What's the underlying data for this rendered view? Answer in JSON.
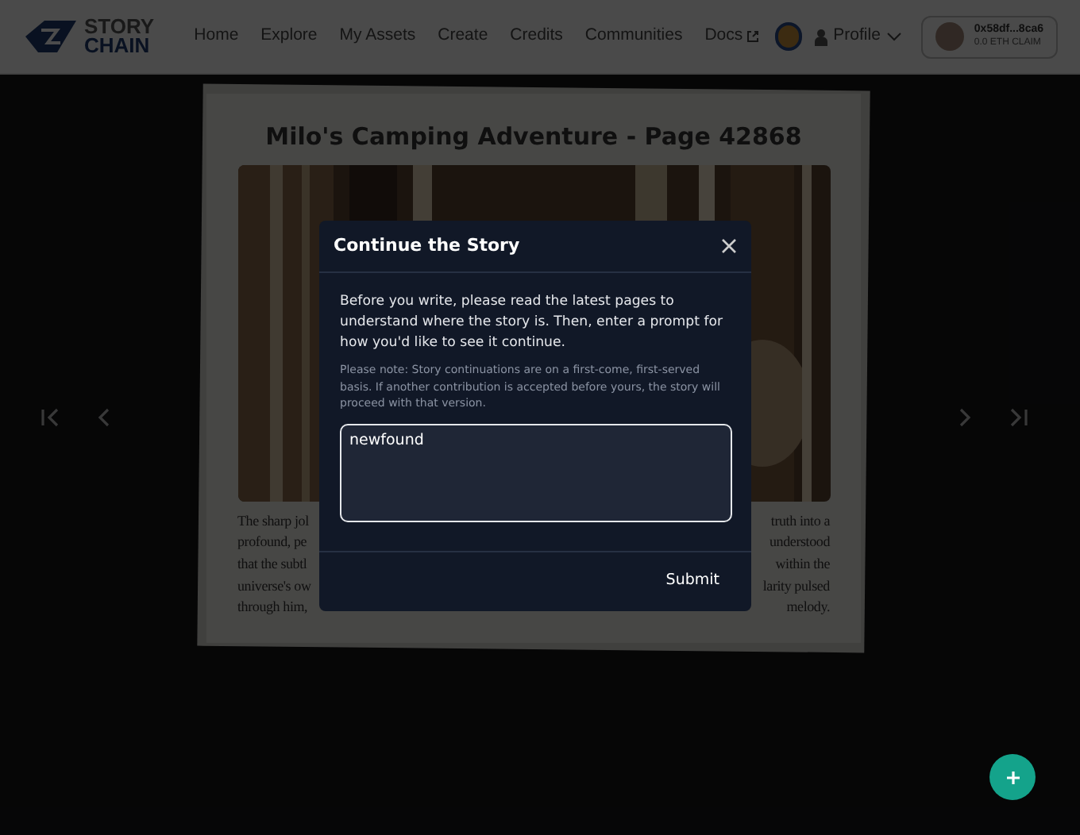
{
  "nav": {
    "logo_top": "STORY",
    "logo_bottom": "CHAIN",
    "links": [
      {
        "label": "Home"
      },
      {
        "label": "Explore"
      },
      {
        "label": "My Assets"
      },
      {
        "label": "Create"
      },
      {
        "label": "Credits"
      },
      {
        "label": "Communities"
      },
      {
        "label": "Docs",
        "external": true
      }
    ],
    "profile": "Profile",
    "wallet": {
      "address": "0x58df...8ca6",
      "balance": "0.0 ETH CLAIM"
    }
  },
  "page": {
    "title": "Milo's Camping Adventure - Page 42868",
    "story_lines": [
      {
        "left": "The sharp jol",
        "right": "truth into a"
      },
      {
        "left": "profound, pe",
        "right": "understood"
      },
      {
        "left": "that the subtl",
        "right": "within the"
      },
      {
        "left": "universe's ow",
        "right": "larity pulsed"
      },
      {
        "left": "through him,",
        "right": "melody."
      }
    ]
  },
  "modal": {
    "title": "Continue the Story",
    "intro": "Before you write, please read the latest pages to understand where the story is. Then, enter a prompt for how you'd like to see it continue.",
    "note": "Please note: Story continuations are on a first-come, first-served basis. If another contribution is accepted before yours, the story will proceed with that version.",
    "prompt_value": "newfound",
    "submit": "Submit"
  }
}
